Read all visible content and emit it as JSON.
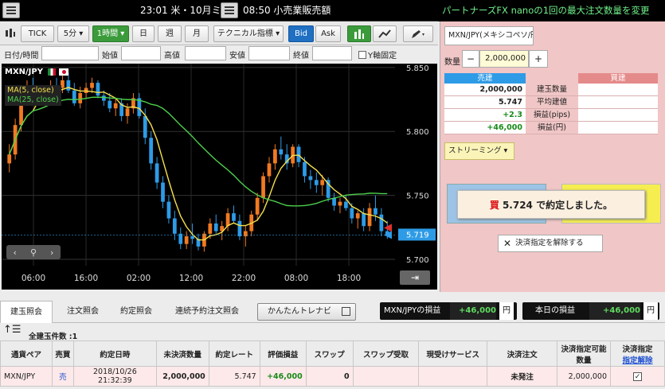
{
  "ticker": {
    "time_news": "23:01 米・10月ミ",
    "time_news2": "08:50 小売業販売額"
  },
  "banner": {
    "text": "パートナーズFX nanoの1回の最大注文数量を変更"
  },
  "toolbar": {
    "tick": "TICK",
    "interval_5m": "5分 ▾",
    "interval_1h": "1時間 ▾",
    "day": "日",
    "week": "週",
    "month": "月",
    "technical": "テクニカル指標 ▾",
    "bid": "Bid",
    "ask": "Ask"
  },
  "ohlc": {
    "datetime": "日付/時間",
    "open": "始値",
    "high": "高値",
    "low": "安値",
    "close": "終値",
    "y_fixed": "Y軸固定"
  },
  "chart_data": {
    "type": "candlestick",
    "title": "MXN/JPY",
    "legend": [
      "MA(5, close)",
      "MA(25, close)"
    ],
    "y_ticks": [
      5.85,
      5.8,
      5.75,
      5.7
    ],
    "ylim": [
      5.695,
      5.853
    ],
    "x_ticks": [
      "06:00",
      "16:00",
      "02:00",
      "12:00",
      "22:00",
      "08:00",
      "18:00"
    ],
    "current_price": "5.719",
    "candles": [
      [
        5.775,
        5.79,
        5.768,
        5.782
      ],
      [
        5.782,
        5.81,
        5.778,
        5.805
      ],
      [
        5.805,
        5.832,
        5.8,
        5.826
      ],
      [
        5.826,
        5.84,
        5.82,
        5.835
      ],
      [
        5.835,
        5.842,
        5.828,
        5.832
      ],
      [
        5.832,
        5.836,
        5.82,
        5.824
      ],
      [
        5.824,
        5.836,
        5.82,
        5.83
      ],
      [
        5.83,
        5.84,
        5.826,
        5.836
      ],
      [
        5.836,
        5.842,
        5.83,
        5.834
      ],
      [
        5.834,
        5.845,
        5.83,
        5.84
      ],
      [
        5.84,
        5.846,
        5.83,
        5.832
      ],
      [
        5.832,
        5.838,
        5.82,
        5.822
      ],
      [
        5.822,
        5.835,
        5.818,
        5.83
      ],
      [
        5.83,
        5.838,
        5.826,
        5.834
      ],
      [
        5.834,
        5.842,
        5.83,
        5.838
      ],
      [
        5.838,
        5.84,
        5.826,
        5.828
      ],
      [
        5.828,
        5.832,
        5.82,
        5.824
      ],
      [
        5.824,
        5.83,
        5.815,
        5.818
      ],
      [
        5.818,
        5.826,
        5.812,
        5.822
      ],
      [
        5.822,
        5.826,
        5.808,
        5.812
      ],
      [
        5.812,
        5.822,
        5.806,
        5.818
      ],
      [
        5.818,
        5.83,
        5.814,
        5.826
      ],
      [
        5.826,
        5.83,
        5.81,
        5.812
      ],
      [
        5.812,
        5.818,
        5.79,
        5.795
      ],
      [
        5.795,
        5.8,
        5.77,
        5.775
      ],
      [
        5.775,
        5.78,
        5.755,
        5.76
      ],
      [
        5.76,
        5.765,
        5.74,
        5.745
      ],
      [
        5.745,
        5.75,
        5.728,
        5.732
      ],
      [
        5.732,
        5.738,
        5.715,
        5.72
      ],
      [
        5.72,
        5.725,
        5.708,
        5.712
      ],
      [
        5.712,
        5.722,
        5.708,
        5.718
      ],
      [
        5.718,
        5.728,
        5.712,
        5.716
      ],
      [
        5.716,
        5.72,
        5.707,
        5.71
      ],
      [
        5.71,
        5.722,
        5.706,
        5.72
      ],
      [
        5.72,
        5.732,
        5.716,
        5.728
      ],
      [
        5.728,
        5.735,
        5.72,
        5.722
      ],
      [
        5.722,
        5.73,
        5.715,
        5.726
      ],
      [
        5.726,
        5.74,
        5.722,
        5.736
      ],
      [
        5.736,
        5.742,
        5.728,
        5.73
      ],
      [
        5.73,
        5.735,
        5.715,
        5.718
      ],
      [
        5.718,
        5.726,
        5.71,
        5.722
      ],
      [
        5.722,
        5.738,
        5.718,
        5.735
      ],
      [
        5.735,
        5.752,
        5.73,
        5.748
      ],
      [
        5.748,
        5.768,
        5.744,
        5.765
      ],
      [
        5.765,
        5.78,
        5.76,
        5.775
      ],
      [
        5.775,
        5.79,
        5.77,
        5.786
      ],
      [
        5.786,
        5.796,
        5.778,
        5.782
      ],
      [
        5.782,
        5.79,
        5.77,
        5.775
      ],
      [
        5.775,
        5.79,
        5.772,
        5.788
      ],
      [
        5.788,
        5.79,
        5.772,
        5.776
      ],
      [
        5.776,
        5.78,
        5.76,
        5.765
      ],
      [
        5.765,
        5.77,
        5.755,
        5.762
      ],
      [
        5.762,
        5.768,
        5.752,
        5.758
      ],
      [
        5.758,
        5.766,
        5.75,
        5.762
      ],
      [
        5.762,
        5.764,
        5.745,
        5.748
      ],
      [
        5.748,
        5.752,
        5.738,
        5.742
      ],
      [
        5.742,
        5.748,
        5.736,
        5.745
      ],
      [
        5.745,
        5.75,
        5.738,
        5.74
      ],
      [
        5.74,
        5.744,
        5.728,
        5.732
      ],
      [
        5.732,
        5.738,
        5.724,
        5.736
      ],
      [
        5.736,
        5.74,
        5.722,
        5.726
      ],
      [
        5.726,
        5.744,
        5.722,
        5.74
      ],
      [
        5.74,
        5.75,
        5.73,
        5.735
      ],
      [
        5.735,
        5.74,
        5.718,
        5.722
      ],
      [
        5.722,
        5.73,
        5.716,
        5.719
      ]
    ]
  },
  "order": {
    "pair": "MXN/JPY(メキシコペソ/円)",
    "qty_label": "数量",
    "qty_value": "2,000,000",
    "minus": "−",
    "plus": "+",
    "sell_header": "売建",
    "buy_header": "買建",
    "rows": [
      {
        "sell": "2,000,000",
        "label": "建玉数量",
        "buy": ""
      },
      {
        "sell": "5.747",
        "label": "平均建値",
        "buy": ""
      },
      {
        "sell": "+2.3",
        "label": "損益(pips)",
        "buy": ""
      },
      {
        "sell": "+46,000",
        "label": "損益(円)",
        "buy": ""
      }
    ],
    "streaming": "ストリーミング ▾",
    "toast_buy": "買",
    "toast_text": "5.724 で約定しました。",
    "cancel_btn": "決済指定を解除する"
  },
  "tabs": {
    "items": [
      "建玉照会",
      "注文照会",
      "約定照会",
      "連続予約注文照会"
    ],
    "easy_navi": "かんたんトレナビ",
    "pair_pl_label": "MXN/JPYの損益",
    "pair_pl_value": "+46,000",
    "pair_pl_unit": "円",
    "today_pl_label": "本日の損益",
    "today_pl_value": "+46,000",
    "today_pl_unit": "円"
  },
  "positions": {
    "count_label": "全建玉件数 :1",
    "headers": [
      "通貨ペア",
      "売買",
      "約定日時",
      "未決済数量",
      "約定レート",
      "評価損益",
      "スワップ",
      "スワップ受取",
      "現受けサービス",
      "決済注文",
      "決済指定可能数量",
      "決済指定"
    ],
    "header_cancel": "指定解除",
    "row": {
      "pair": "MXN/JPY",
      "side": "売",
      "datetime": "2018/10/26 21:32:39",
      "qty": "2,000,000",
      "rate": "5.747",
      "pl": "+46,000",
      "swap": "0",
      "swap_recv": "",
      "physical": "",
      "settle_order": "未発注",
      "settle_qty": "2,000,000"
    }
  }
}
